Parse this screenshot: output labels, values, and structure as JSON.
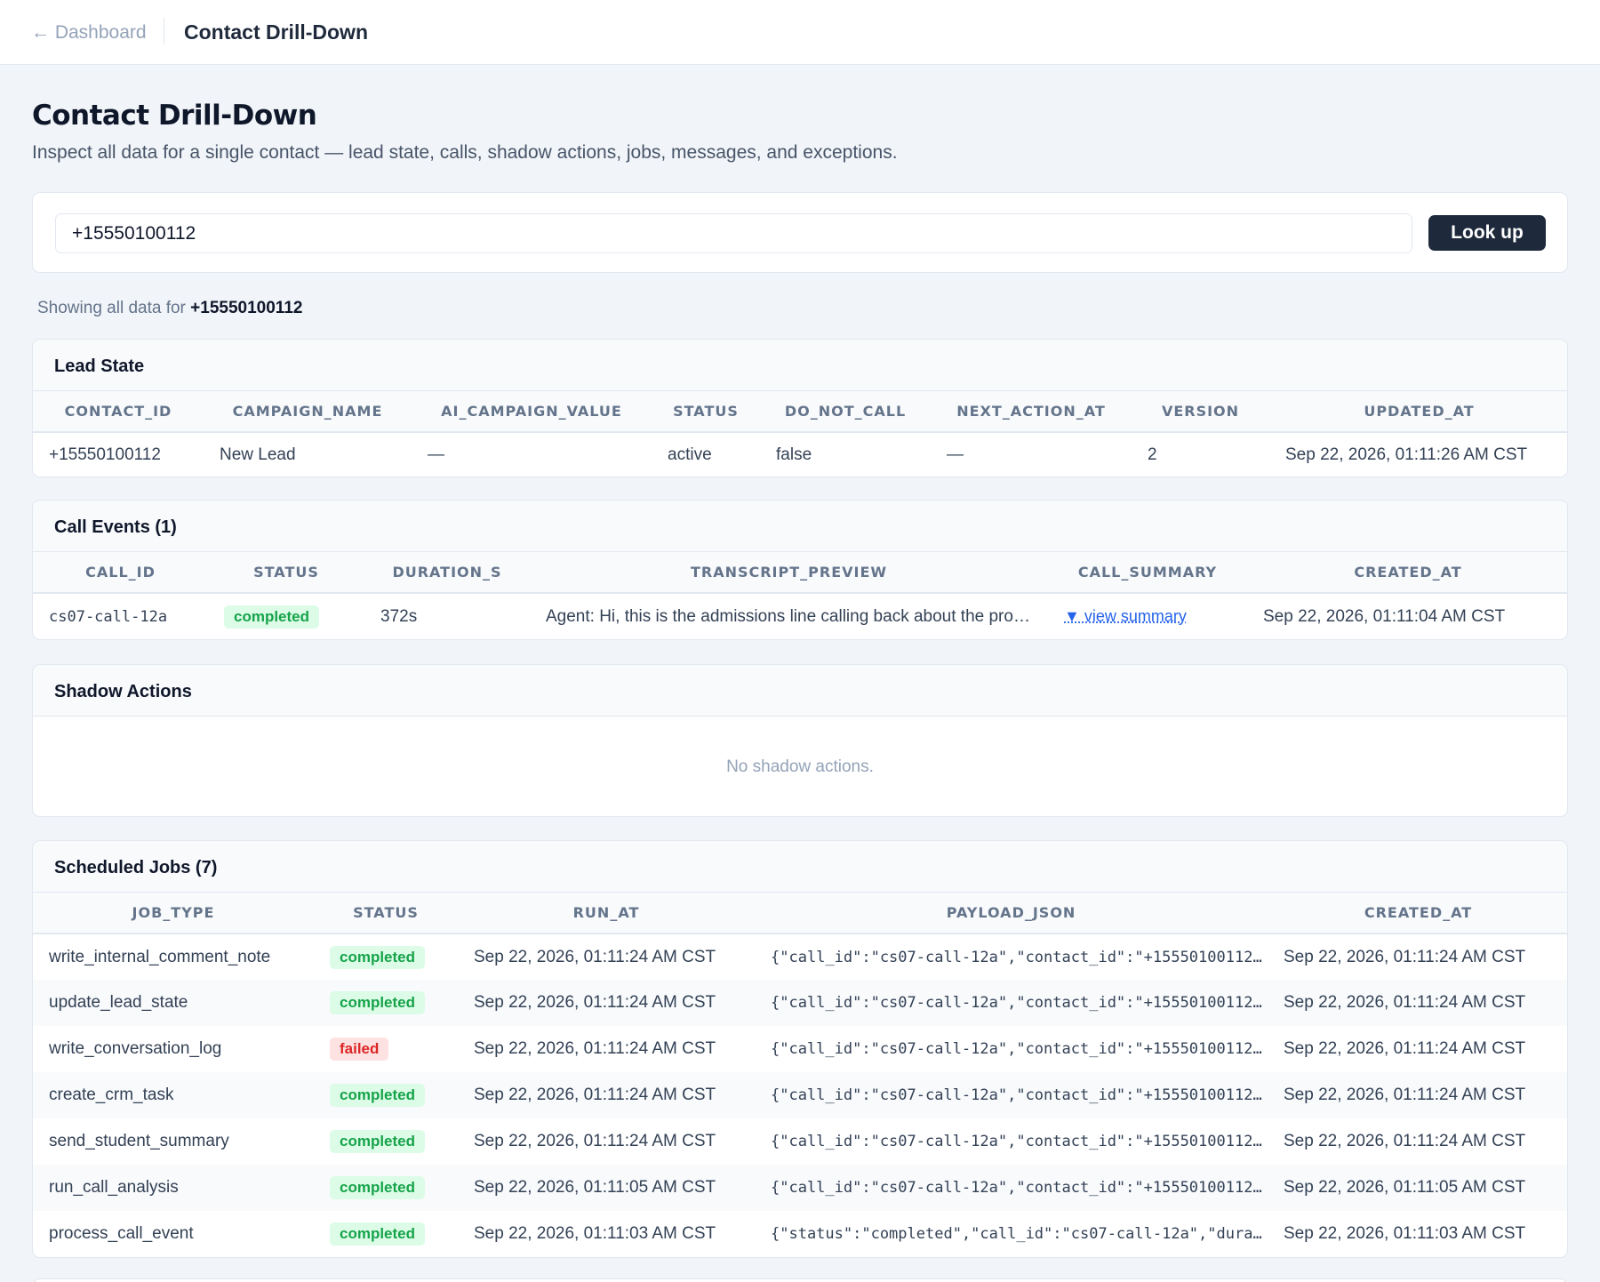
{
  "topbar": {
    "back_label": "← Dashboard",
    "title": "Contact Drill-Down"
  },
  "page": {
    "title": "Contact Drill-Down",
    "subtitle": "Inspect all data for a single contact — lead state, calls, shadow actions, jobs, messages, and exceptions."
  },
  "search": {
    "value": "+15550100112",
    "button_label": "Look up"
  },
  "showing": {
    "prefix": "Showing all data for",
    "contact": "+15550100112"
  },
  "lead_state": {
    "title": "Lead State",
    "headers": [
      "CONTACT_ID",
      "CAMPAIGN_NAME",
      "AI_CAMPAIGN_VALUE",
      "STATUS",
      "DO_NOT_CALL",
      "NEXT_ACTION_AT",
      "VERSION",
      "UPDATED_AT"
    ],
    "row": [
      "+15550100112",
      "New Lead",
      "—",
      "active",
      "false",
      "—",
      "2",
      "Sep 22, 2026, 01:11:26 AM CST"
    ]
  },
  "call_events": {
    "title": "Call Events (1)",
    "headers": [
      "CALL_ID",
      "STATUS",
      "DURATION_S",
      "TRANSCRIPT_PREVIEW",
      "CALL_SUMMARY",
      "CREATED_AT"
    ],
    "rows": [
      {
        "call_id": "cs07-call-12a",
        "status": "completed",
        "duration": "372s",
        "transcript": "Agent: Hi, this is the admissions line calling back about the pro…",
        "summary_link": "▼ view summary",
        "created_at": "Sep 22, 2026, 01:11:04 AM CST"
      }
    ]
  },
  "shadow_actions": {
    "title": "Shadow Actions",
    "empty_text": "No shadow actions."
  },
  "scheduled_jobs": {
    "title": "Scheduled Jobs (7)",
    "headers": [
      "JOB_TYPE",
      "STATUS",
      "RUN_AT",
      "PAYLOAD_JSON",
      "CREATED_AT"
    ],
    "rows": [
      {
        "job_type": "write_internal_comment_note",
        "status": "completed",
        "run_at": "Sep 22, 2026, 01:11:24 AM CST",
        "payload": "{\"call_id\":\"cs07-call-12a\",\"contact_id\":\"+15550100112…",
        "created_at": "Sep 22, 2026, 01:11:24 AM CST"
      },
      {
        "job_type": "update_lead_state",
        "status": "completed",
        "run_at": "Sep 22, 2026, 01:11:24 AM CST",
        "payload": "{\"call_id\":\"cs07-call-12a\",\"contact_id\":\"+15550100112…",
        "created_at": "Sep 22, 2026, 01:11:24 AM CST"
      },
      {
        "job_type": "write_conversation_log",
        "status": "failed",
        "run_at": "Sep 22, 2026, 01:11:24 AM CST",
        "payload": "{\"call_id\":\"cs07-call-12a\",\"contact_id\":\"+15550100112…",
        "created_at": "Sep 22, 2026, 01:11:24 AM CST"
      },
      {
        "job_type": "create_crm_task",
        "status": "completed",
        "run_at": "Sep 22, 2026, 01:11:24 AM CST",
        "payload": "{\"call_id\":\"cs07-call-12a\",\"contact_id\":\"+15550100112…",
        "created_at": "Sep 22, 2026, 01:11:24 AM CST"
      },
      {
        "job_type": "send_student_summary",
        "status": "completed",
        "run_at": "Sep 22, 2026, 01:11:24 AM CST",
        "payload": "{\"call_id\":\"cs07-call-12a\",\"contact_id\":\"+15550100112…",
        "created_at": "Sep 22, 2026, 01:11:24 AM CST"
      },
      {
        "job_type": "run_call_analysis",
        "status": "completed",
        "run_at": "Sep 22, 2026, 01:11:05 AM CST",
        "payload": "{\"call_id\":\"cs07-call-12a\",\"contact_id\":\"+15550100112…",
        "created_at": "Sep 22, 2026, 01:11:05 AM CST"
      },
      {
        "job_type": "process_call_event",
        "status": "completed",
        "run_at": "Sep 22, 2026, 01:11:03 AM CST",
        "payload": "{\"status\":\"completed\",\"call_id\":\"cs07-call-12a\",\"dura…",
        "created_at": "Sep 22, 2026, 01:11:03 AM CST"
      }
    ]
  }
}
